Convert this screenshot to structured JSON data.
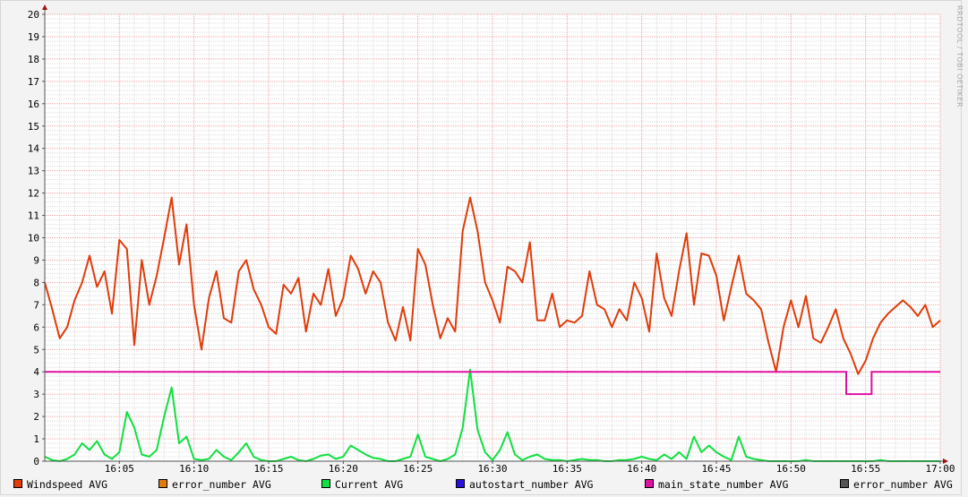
{
  "chart_data": {
    "type": "line",
    "title": "",
    "xlabel": "",
    "ylabel": "",
    "ylim": [
      0,
      20
    ],
    "xlim_minutes": [
      0,
      60
    ],
    "x_start_time": "16:00",
    "x_step_minutes": 0.5,
    "grid": true,
    "legend_placement": "bottom",
    "y_ticks": [
      "0",
      "1",
      "2",
      "3",
      "4",
      "5",
      "6",
      "7",
      "8",
      "9",
      "10",
      "11",
      "12",
      "13",
      "14",
      "15",
      "16",
      "17",
      "18",
      "19",
      "20"
    ],
    "x_ticks": [
      {
        "minute": 5,
        "label": "16:05"
      },
      {
        "minute": 10,
        "label": "16:10"
      },
      {
        "minute": 15,
        "label": "16:15"
      },
      {
        "minute": 20,
        "label": "16:20"
      },
      {
        "minute": 25,
        "label": "16:25"
      },
      {
        "minute": 30,
        "label": "16:30"
      },
      {
        "minute": 35,
        "label": "16:35"
      },
      {
        "minute": 40,
        "label": "16:40"
      },
      {
        "minute": 45,
        "label": "16:45"
      },
      {
        "minute": 50,
        "label": "16:50"
      },
      {
        "minute": 55,
        "label": "16:55"
      },
      {
        "minute": 60,
        "label": "17:00"
      }
    ],
    "series": [
      {
        "name": "Windspeed AVG",
        "color": "#e03c0a",
        "values": [
          8.0,
          6.8,
          5.5,
          6.0,
          7.2,
          8.0,
          9.2,
          7.8,
          8.5,
          6.6,
          9.9,
          9.5,
          5.2,
          9.0,
          7.0,
          8.3,
          10.0,
          11.8,
          8.8,
          10.6,
          7.0,
          5.0,
          7.3,
          8.5,
          6.4,
          6.2,
          8.5,
          9.0,
          7.7,
          7.0,
          6.0,
          5.7,
          7.9,
          7.5,
          8.2,
          5.8,
          7.5,
          7.0,
          8.6,
          6.5,
          7.3,
          9.2,
          8.6,
          7.5,
          8.5,
          8.0,
          6.2,
          5.4,
          6.9,
          5.4,
          9.5,
          8.8,
          7.0,
          5.5,
          6.4,
          5.8,
          10.3,
          11.8,
          10.3,
          8.0,
          7.2,
          6.2,
          8.7,
          8.5,
          8.0,
          9.8,
          6.3,
          6.3,
          7.5,
          6.0,
          6.3,
          6.2,
          6.5,
          8.5,
          7.0,
          6.8,
          6.0,
          6.8,
          6.3,
          8.0,
          7.3,
          5.8,
          9.3,
          7.3,
          6.5,
          8.5,
          10.2,
          7.0,
          9.3,
          9.2,
          8.3,
          6.3,
          7.8,
          9.2,
          7.5,
          7.2,
          6.8,
          5.3,
          4.0,
          6.0,
          7.2,
          6.0,
          7.4,
          5.5,
          5.3,
          6.0,
          6.8,
          5.5,
          4.8,
          3.9,
          4.5,
          5.5,
          6.2,
          6.6,
          6.9,
          7.2,
          6.9,
          6.5,
          7.0,
          6.0,
          6.3
        ]
      },
      {
        "name": "error_number AVG",
        "color": "#e07a0a",
        "values": []
      },
      {
        "name": "Current AVG",
        "color": "#10e040",
        "values": [
          0.2,
          0.05,
          0,
          0.1,
          0.3,
          0.8,
          0.5,
          0.9,
          0.3,
          0.1,
          0.4,
          2.2,
          1.5,
          0.3,
          0.2,
          0.5,
          2.0,
          3.3,
          0.8,
          1.1,
          0.1,
          0.05,
          0.1,
          0.5,
          0.2,
          0.05,
          0.4,
          0.8,
          0.2,
          0.05,
          0,
          0,
          0.1,
          0.2,
          0.05,
          0,
          0.1,
          0.25,
          0.3,
          0.1,
          0.2,
          0.7,
          0.5,
          0.3,
          0.15,
          0.1,
          0,
          0,
          0.1,
          0.2,
          1.2,
          0.2,
          0.1,
          0,
          0.1,
          0.3,
          1.5,
          4.1,
          1.4,
          0.4,
          0.05,
          0.5,
          1.3,
          0.3,
          0.05,
          0.2,
          0.3,
          0.1,
          0.05,
          0.05,
          0,
          0.05,
          0.1,
          0.05,
          0.05,
          0,
          0,
          0.05,
          0.05,
          0.1,
          0.2,
          0.1,
          0.05,
          0.3,
          0.1,
          0.4,
          0.1,
          1.1,
          0.4,
          0.7,
          0.4,
          0.2,
          0.05,
          1.1,
          0.2,
          0.1,
          0.05,
          0,
          0,
          0,
          0,
          0,
          0.05,
          0,
          0,
          0,
          0,
          0,
          0,
          0,
          0,
          0,
          0.05,
          0,
          0,
          0,
          0,
          0,
          0,
          0,
          0
        ]
      },
      {
        "name": "autostart_number AVG",
        "color": "#2a10e0",
        "values": []
      },
      {
        "name": "main_state_number AVG",
        "color": "#e010a0",
        "steps": [
          {
            "from": 0,
            "to": 53.7,
            "value": 4
          },
          {
            "from": 53.7,
            "to": 55.4,
            "value": 3
          },
          {
            "from": 55.4,
            "to": 60,
            "value": 4
          }
        ]
      },
      {
        "name": "error_number AVG",
        "color": "#555555",
        "values": []
      }
    ]
  },
  "watermark": "RRDTOOL / TOBI OETIKER"
}
